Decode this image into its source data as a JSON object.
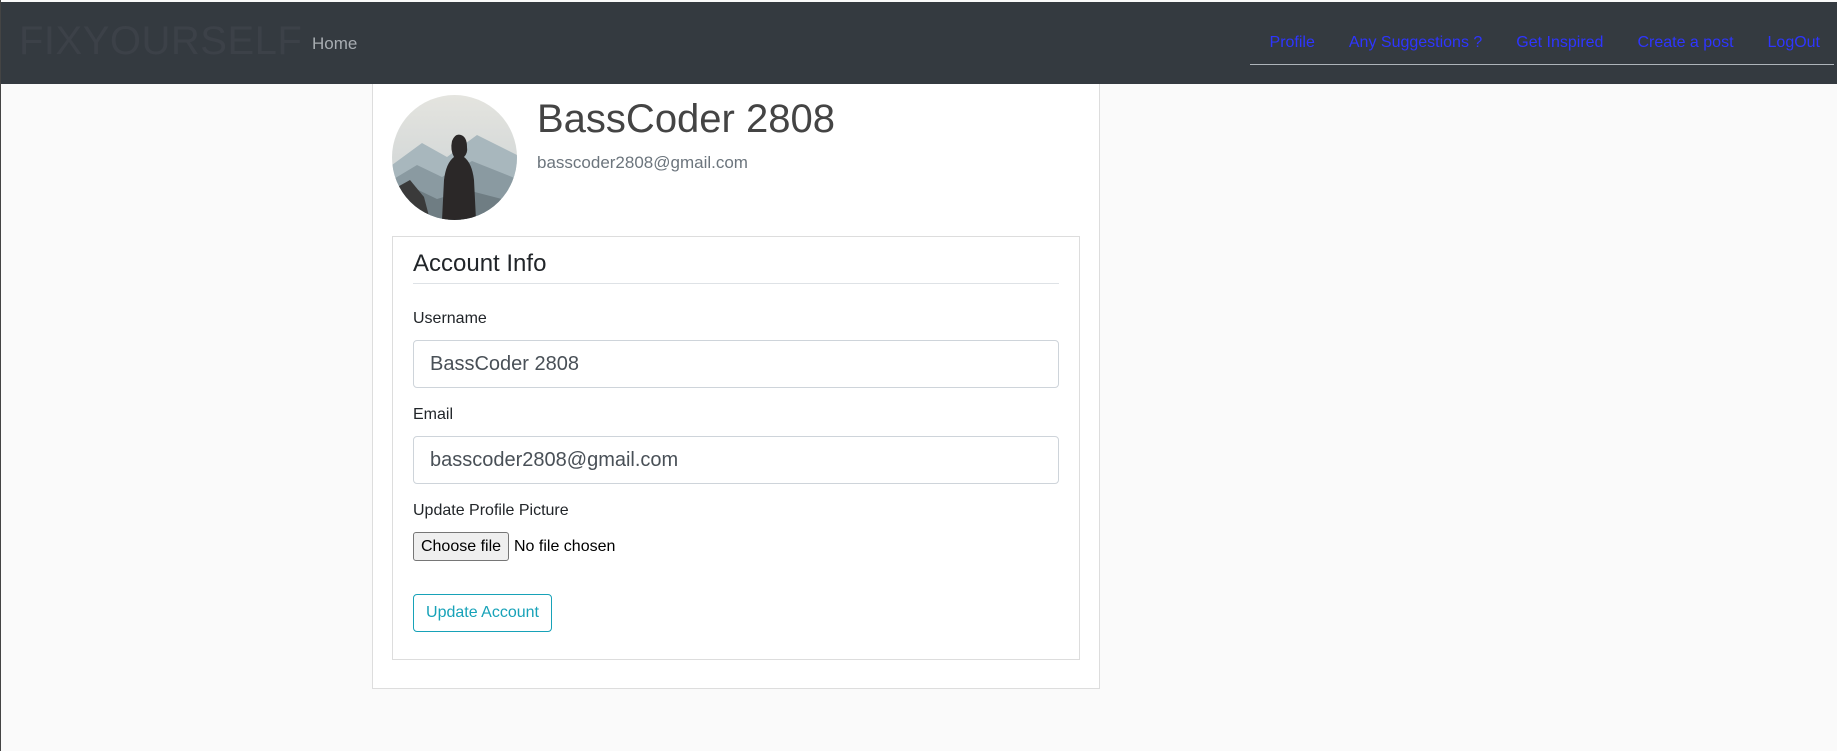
{
  "navbar": {
    "brand": "FIXYOURSELF",
    "home_label": "Home",
    "links": [
      "Profile",
      "Any Suggestions ?",
      "Get Inspired",
      "Create a post",
      "LogOut"
    ]
  },
  "profile": {
    "username_heading": "BassCoder 2808",
    "email_text": "basscoder2808@gmail.com"
  },
  "form": {
    "legend": "Account Info",
    "username_label": "Username",
    "username_value": "BassCoder 2808",
    "email_label": "Email",
    "email_value": "basscoder2808@gmail.com",
    "picture_label": "Update Profile Picture",
    "file_button_label": "Choose file",
    "file_status": "No file chosen",
    "submit_label": "Update Account"
  },
  "colors": {
    "navbar_bg": "#343a40",
    "link": "#2e35ff",
    "button_outline": "#17a2b8",
    "page_bg": "#fafafa"
  }
}
